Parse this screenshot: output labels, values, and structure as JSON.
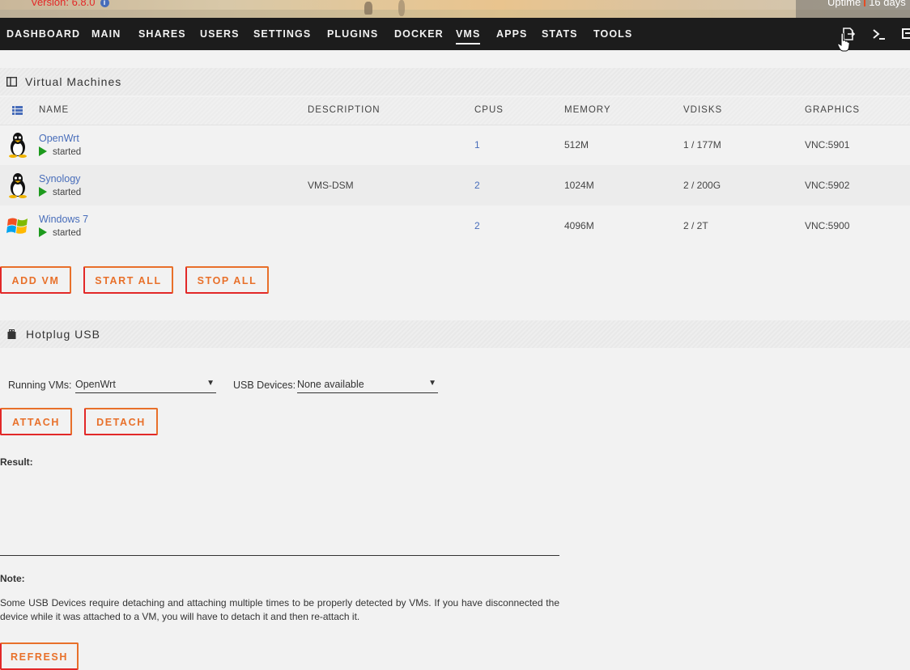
{
  "header": {
    "version_text": "Version: 6.8.0",
    "info_icon": "info-icon",
    "uptime_label": "Uptime",
    "uptime_value": "16 days"
  },
  "nav": {
    "items": [
      "DASHBOARD",
      "MAIN",
      "SHARES",
      "USERS",
      "SETTINGS",
      "PLUGINS",
      "DOCKER",
      "VMS",
      "APPS",
      "STATS",
      "TOOLS"
    ],
    "active": "VMS",
    "right_icons": [
      "logout-icon",
      "terminal-icon",
      "feedback-icon"
    ]
  },
  "vms": {
    "section_title": "Virtual Machines",
    "section_icon": "window-icon",
    "columns": [
      "NAME",
      "DESCRIPTION",
      "CPUS",
      "MEMORY",
      "VDISKS",
      "GRAPHICS"
    ],
    "rows": [
      {
        "name": "OpenWrt",
        "status": "started",
        "description": "",
        "cpus": "1",
        "memory": "512M",
        "vdisks": "1 / 177M",
        "graphics": "VNC:5901",
        "icon": "linux-tux-icon"
      },
      {
        "name": "Synology",
        "status": "started",
        "description": "VMS-DSM",
        "cpus": "2",
        "memory": "1024M",
        "vdisks": "2 / 200G",
        "graphics": "VNC:5902",
        "icon": "linux-tux-icon"
      },
      {
        "name": "Windows 7",
        "status": "started",
        "description": "",
        "cpus": "2",
        "memory": "4096M",
        "vdisks": "2 / 2T",
        "graphics": "VNC:5900",
        "icon": "windows-logo-icon"
      }
    ],
    "buttons": {
      "add": "ADD VM",
      "start_all": "START ALL",
      "stop_all": "STOP ALL"
    }
  },
  "hotplug": {
    "section_title": "Hotplug USB",
    "section_icon": "usb-icon",
    "running_vms_label": "Running VMs:",
    "running_vms_value": "OpenWrt",
    "usb_devices_label": "USB Devices:",
    "usb_devices_value": "None available",
    "attach": "ATTACH",
    "detach": "DETACH",
    "result_label": "Result:",
    "note_label": "Note:",
    "note_text": "Some USB Devices require detaching and attaching multiple times to be properly detected by VMs.  If you have disconnected the device while it was attached to a VM, you will have to detach it and then re-attach it.",
    "refresh": "REFRESH"
  },
  "colors": {
    "accent_orange": "#e8702a",
    "accent_red": "#e22828",
    "link_blue": "#486dba",
    "nav_bg": "#1c1c1c",
    "status_green": "#1d9a1d"
  }
}
